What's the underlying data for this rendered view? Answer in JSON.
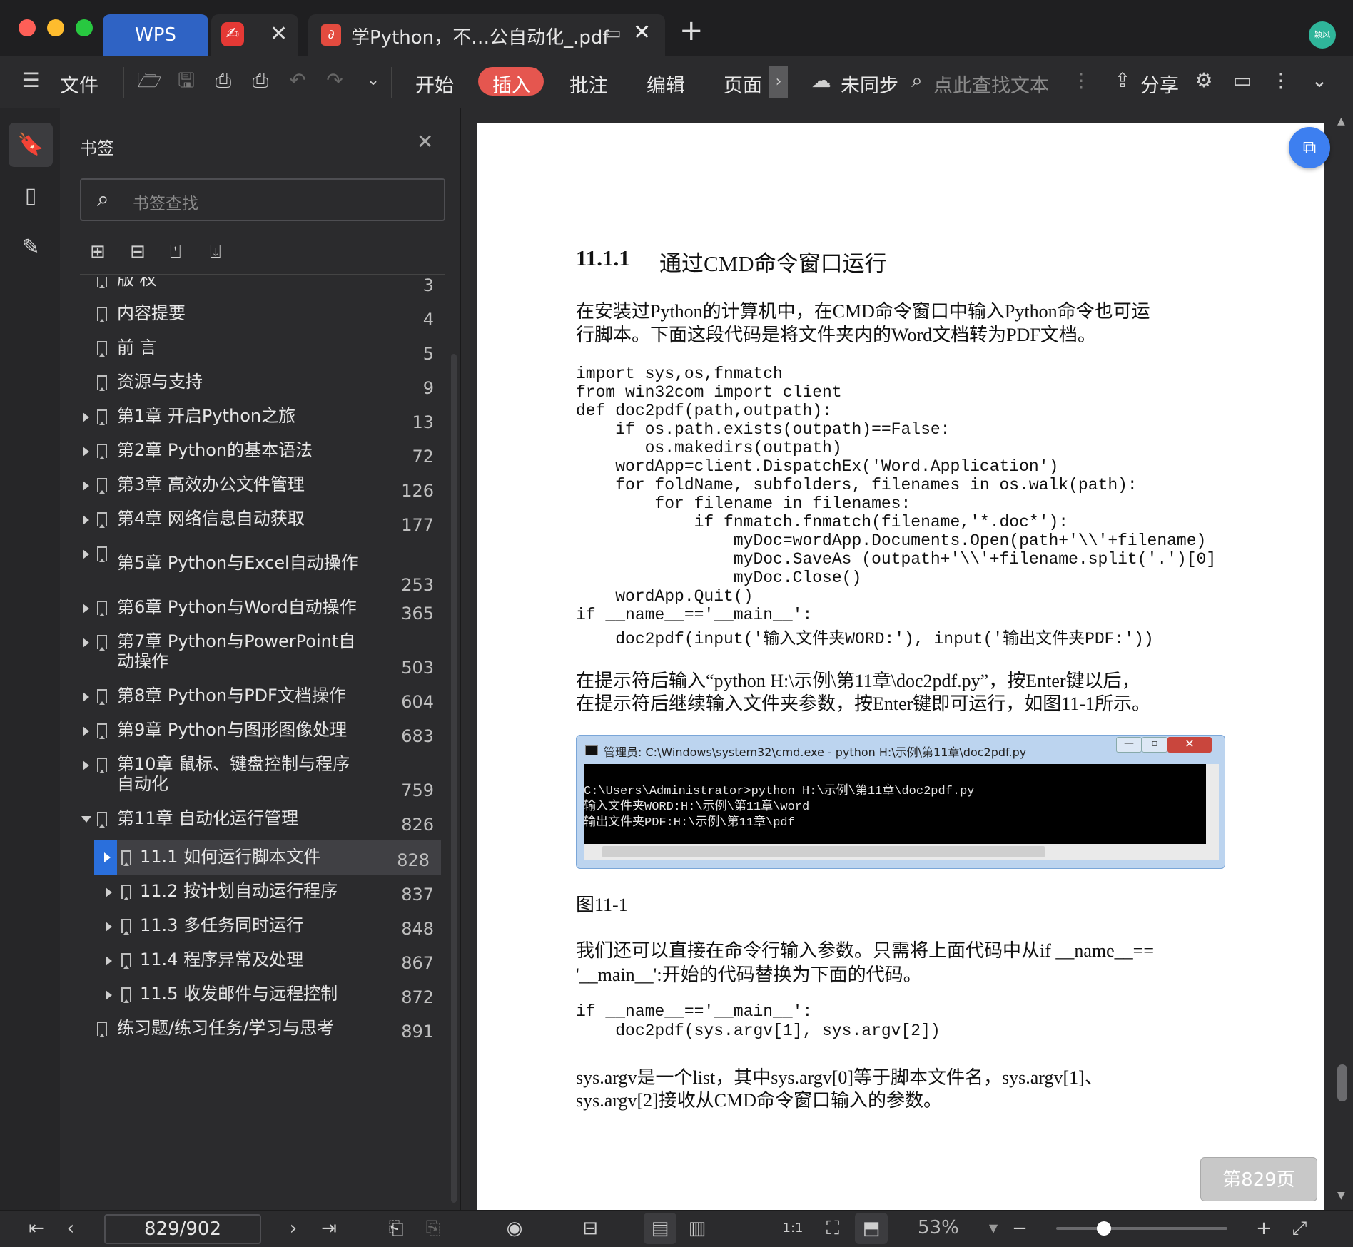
{
  "titlebar": {
    "wps_tab": "WPS",
    "doc_tab": "学Python，不…公自动化_.pdf",
    "new_tab": "+",
    "avatar_text": "颖风"
  },
  "toolbar": {
    "file": "文件",
    "tabs": [
      "开始",
      "插入",
      "批注",
      "编辑",
      "页面"
    ],
    "sync": "未同步",
    "search_placeholder": "点此查找文本",
    "share": "分享"
  },
  "panel": {
    "title": "书签",
    "search_placeholder": "书签查找",
    "items": [
      {
        "label": "版 权",
        "page": "3"
      },
      {
        "label": "内容提要",
        "page": "4"
      },
      {
        "label": "前 言",
        "page": "5"
      },
      {
        "label": "资源与支持",
        "page": "9"
      },
      {
        "label": "第1章 开启Python之旅",
        "page": "13"
      },
      {
        "label": "第2章 Python的基本语法",
        "page": "72"
      },
      {
        "label": "第3章 高效办公文件管理",
        "page": "126"
      },
      {
        "label": "第4章 网络信息自动获取",
        "page": "177"
      },
      {
        "label": "第5章 Python与Excel自动操作",
        "page": "253"
      },
      {
        "label": "第6章 Python与Word自动操作",
        "page": "365"
      },
      {
        "label": "第7章 Python与PowerPoint自",
        "label2": "动操作",
        "page": "503"
      },
      {
        "label": "第8章 Python与PDF文档操作",
        "page": "604"
      },
      {
        "label": "第9章 Python与图形图像处理",
        "page": "683"
      },
      {
        "label": "第10章 鼠标、键盘控制与程序",
        "label2": "自动化",
        "page": "759"
      },
      {
        "label": "第11章 自动化运行管理",
        "page": "826"
      },
      {
        "label": "11.1 如何运行脚本文件",
        "page": "828"
      },
      {
        "label": "11.2 按计划自动运行程序",
        "page": "837"
      },
      {
        "label": "11.3 多任务同时运行",
        "page": "848"
      },
      {
        "label": "11.4 程序异常及处理",
        "page": "867"
      },
      {
        "label": "11.5 收发邮件与远程控制",
        "page": "872"
      },
      {
        "label": "练习题/练习任务/学习与思考",
        "page": "891"
      }
    ]
  },
  "doc": {
    "heading_num": "11.1.1",
    "heading_text": "通过CMD命令窗口运行",
    "para1_l1": "在安装过Python的计算机中，在CMD命令窗口中输入Python命令也可运",
    "para1_l2": "行脚本。下面这段代码是将文件夹内的Word文档转为PDF文档。",
    "code1": [
      "import sys,os,fnmatch",
      "from win32com import client",
      "def doc2pdf(path,outpath):",
      "    if os.path.exists(outpath)==False:",
      "       os.makedirs(outpath)",
      "    wordApp=client.DispatchEx('Word.Application')",
      "    for foldName, subfolders, filenames in os.walk(path):",
      "        for filename in filenames:",
      "            if fnmatch.fnmatch(filename,'*.doc*'):",
      "                myDoc=wordApp.Documents.Open(path+'\\\\'+filename)",
      "                myDoc.SaveAs (outpath+'\\\\'+filename.split('.')[0]",
      "                myDoc.Close()",
      "    wordApp.Quit()",
      "if __name__=='__main__':",
      "    doc2pdf(input('输入文件夹WORD:'), input('输出文件夹PDF:'))"
    ],
    "para2_l1": "在提示符后输入“python H:\\示例\\第11章\\doc2pdf.py”，按Enter键以后，",
    "para2_l2": "在提示符后继续输入文件夹参数，按Enter键即可运行，如图11-1所示。",
    "cmd_title": "管理员: C:\\Windows\\system32\\cmd.exe - python  H:\\示例\\第11章\\doc2pdf.py",
    "cmd_lines": [
      "C:\\Users\\Administrator>python H:\\示例\\第11章\\doc2pdf.py",
      "输入文件夹WORD:H:\\示例\\第11章\\word",
      "输出文件夹PDF:H:\\示例\\第11章\\pdf"
    ],
    "figure_caption": "图11-1",
    "para3_l1": "我们还可以直接在命令行输入参数。只需将上面代码中从if __name__==",
    "para3_l2": "'__main__':开始的代码替换为下面的代码。",
    "code2": [
      "if __name__=='__main__':",
      "    doc2pdf(sys.argv[1], sys.argv[2])"
    ],
    "para4_l1": "sys.argv是一个list，其中sys.argv[0]等于脚本文件名，sys.argv[1]、",
    "para4_l2": "sys.argv[2]接收从CMD命令窗口输入的参数。",
    "page_badge": "第829页"
  },
  "bottombar": {
    "page_indicator": "829/902",
    "zoom": "53%",
    "zoom_level": 0.28
  }
}
